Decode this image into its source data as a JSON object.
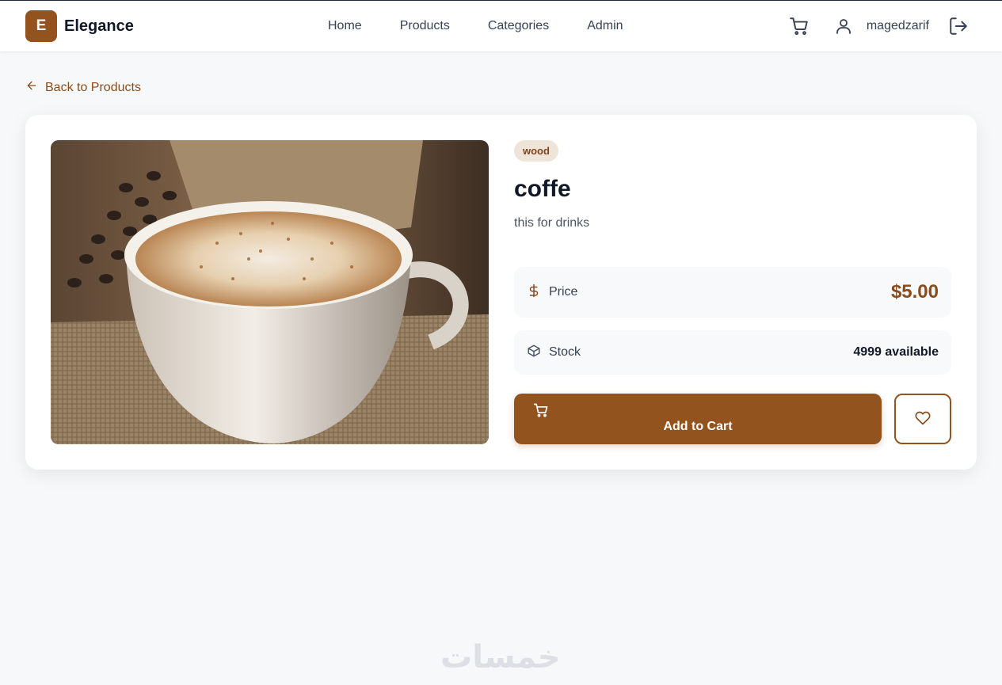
{
  "brand": {
    "initial": "E",
    "name": "Elegance"
  },
  "nav": {
    "links": [
      "Home",
      "Products",
      "Categories",
      "Admin"
    ],
    "username": "magedzarif"
  },
  "icons": {
    "nav_cart": "shopping-cart-icon",
    "nav_user": "user-icon",
    "logout": "logout-icon",
    "back": "arrow-left-icon",
    "price": "dollar-icon",
    "stock": "box-icon",
    "add_cart": "shopping-cart-icon",
    "wishlist": "heart-icon"
  },
  "back_link": "Back to Products",
  "product": {
    "category": "wood",
    "title": "coffe",
    "description": "this for drinks",
    "price_label": "Price",
    "price": "$5.00",
    "stock_label": "Stock",
    "stock": "4999 available",
    "add_to_cart": "Add to Cart"
  },
  "colors": {
    "accent": "#93531f",
    "badge_bg": "#efe4d8",
    "page_bg": "#f7f8fa"
  },
  "watermark": "خمسات"
}
